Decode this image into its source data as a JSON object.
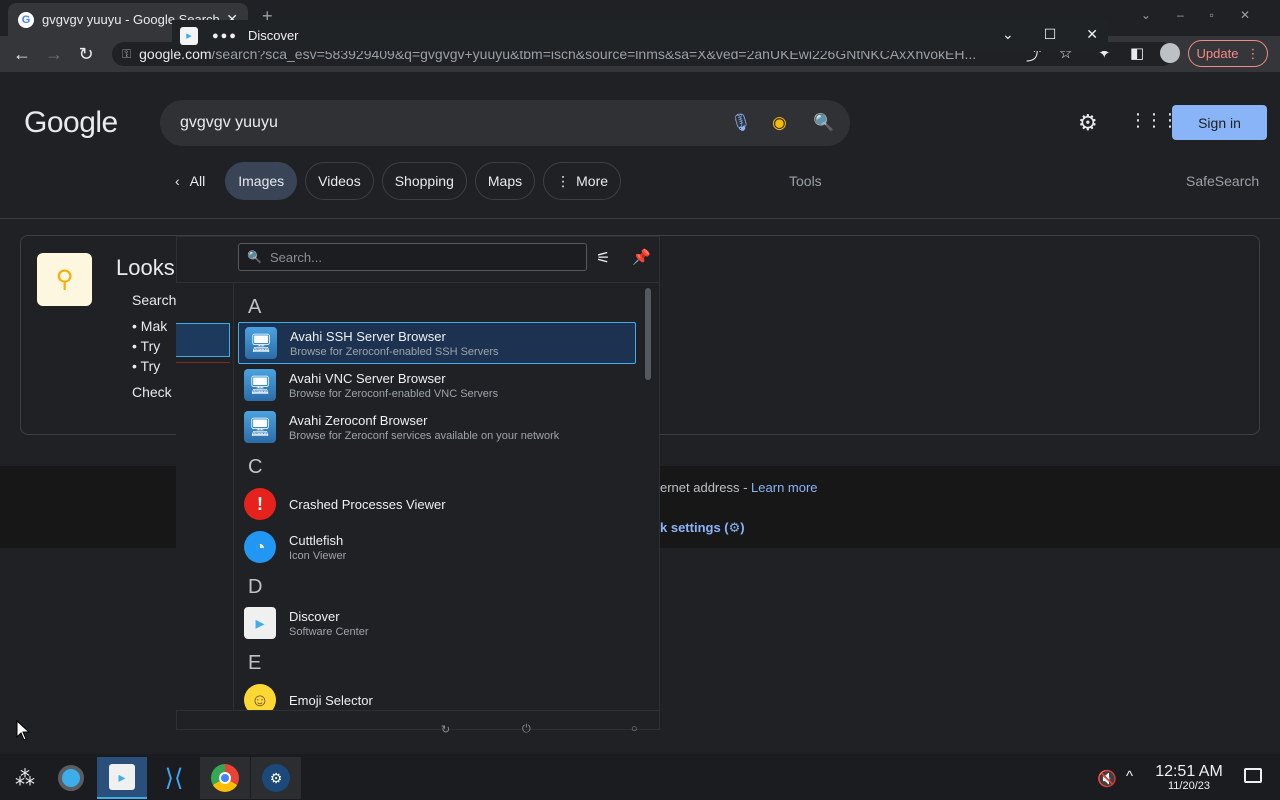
{
  "browser": {
    "tab_title": "gvgvgv yuuyu - Google Search",
    "url_host": "google.com",
    "url_path": "/search?sca_esv=583929409&q=gvgvgv+yuuyu&tbm=isch&source=lnms&sa=X&ved=2ahUKEwi226GNtNKCAxXhvokEH...",
    "update_label": "Update"
  },
  "google": {
    "logo": "Google",
    "query": "gvgvgv yuuyu",
    "sign_in": "Sign in",
    "tabs": [
      "All",
      "Images",
      "Videos",
      "Shopping",
      "Maps",
      "More"
    ],
    "tools": "Tools",
    "safesearch": "SafeSearch",
    "looks_title": "Looks",
    "looks_lines": [
      "Search",
      "Mak",
      "Try",
      "Try",
      "Check"
    ],
    "footer_text": "ernet address - ",
    "footer_link": "Learn more",
    "footer_settings": "k settings"
  },
  "discover": {
    "window_title": "Discover",
    "search_placeholder": "Search...",
    "groups": [
      {
        "letter": "A",
        "apps": [
          {
            "name": "Avahi SSH Server Browser",
            "desc": "Browse for Zeroconf-enabled SSH Servers"
          },
          {
            "name": "Avahi VNC Server Browser",
            "desc": "Browse for Zeroconf-enabled VNC Servers"
          },
          {
            "name": "Avahi Zeroconf Browser",
            "desc": "Browse for Zeroconf services available on your network"
          }
        ]
      },
      {
        "letter": "C",
        "apps": [
          {
            "name": "Crashed Processes Viewer",
            "desc": ""
          },
          {
            "name": "Cuttlefish",
            "desc": "Icon Viewer"
          }
        ]
      },
      {
        "letter": "D",
        "apps": [
          {
            "name": "Discover",
            "desc": "Software Center"
          }
        ]
      },
      {
        "letter": "E",
        "apps": [
          {
            "name": "Emoji Selector",
            "desc": ""
          }
        ]
      }
    ]
  },
  "taskbar": {
    "time": "12:51 AM",
    "date": "11/20/23"
  }
}
